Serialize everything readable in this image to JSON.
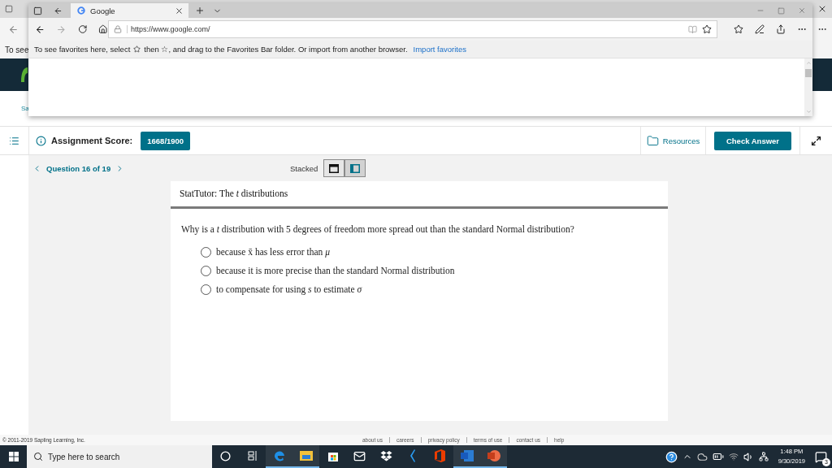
{
  "back_window": {
    "favorites_text": "To see",
    "link_text": "Sa"
  },
  "browser": {
    "tabs": [
      {
        "title": "Google",
        "selected": true
      }
    ],
    "address": "https://www.google.com/",
    "favorites_bar": {
      "text_before": "To see favorites here, select",
      "text_after": "then ☆, and drag to the Favorites Bar folder. Or import from another browser.",
      "link": "Import favorites"
    }
  },
  "assignment": {
    "label": "Assignment Score:",
    "score": "1668/1900",
    "resources": "Resources",
    "check_answer": "Check Answer"
  },
  "navigation": {
    "question": "Question 16 of 19",
    "view_label": "Stacked",
    "views": [
      {
        "kind": "stacked",
        "selected": false
      },
      {
        "kind": "side",
        "selected": true
      }
    ]
  },
  "card": {
    "title": "StatTutor: The *t* distributions",
    "question": "Why is a *t* distribution with 5 degrees of freedom more spread out than the standard Normal distribution?",
    "options": [
      {
        "text": "because x̄ has less error than *μ*",
        "selected": false
      },
      {
        "text": "because it is more precise than the standard Normal distribution",
        "selected": false
      },
      {
        "text": "to compensate for using *s* to estimate *σ*",
        "selected": false
      }
    ]
  },
  "footer": {
    "copyright": "© 2011-2019 Sapling Learning, Inc.",
    "links": [
      "about us",
      "careers",
      "privacy policy",
      "terms of use",
      "contact us",
      "help"
    ]
  },
  "taskbar": {
    "search_placeholder": "Type here to search",
    "apps": [
      {
        "kind": "cortana",
        "running": false
      },
      {
        "kind": "taskview",
        "running": false
      },
      {
        "kind": "edge",
        "running": true
      },
      {
        "kind": "explorer",
        "running": true
      },
      {
        "kind": "store",
        "running": false
      },
      {
        "kind": "mail",
        "running": false
      },
      {
        "kind": "dropbox",
        "running": false
      },
      {
        "kind": "bolt",
        "running": false
      },
      {
        "kind": "office",
        "running": false
      },
      {
        "kind": "word",
        "running": true
      },
      {
        "kind": "powerpoint",
        "running": true
      }
    ],
    "time": "1:48 PM",
    "date": "9/30/2019",
    "notifications": "3"
  }
}
